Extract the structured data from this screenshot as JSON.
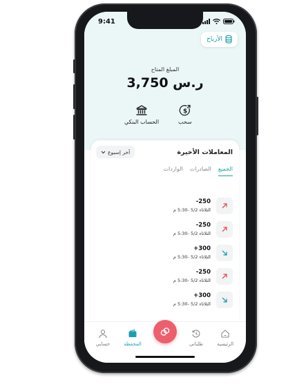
{
  "status": {
    "time": "9:41"
  },
  "header": {
    "profits_label": "الأرباح"
  },
  "balance": {
    "label": "المبلغ المتاح",
    "value": "3,750 ر.س"
  },
  "actions": {
    "withdraw": "سحب",
    "bank": "الحساب البنكي"
  },
  "transactions": {
    "title": "المعاملات الأخيرة",
    "period": "آخر إسبوع",
    "tabs": [
      "الجميع",
      "الصادرات",
      "الواردات"
    ],
    "items": [
      {
        "amount": "-250",
        "date": "الثلاثاء 5/2 -5:30 م",
        "direction": "out"
      },
      {
        "amount": "-250",
        "date": "الثلاثاء 5/2 -5:30 م",
        "direction": "out"
      },
      {
        "amount": "+300",
        "date": "الثلاثاء 5/2 -5:30 م",
        "direction": "in"
      },
      {
        "amount": "-250",
        "date": "الثلاثاء 5/2 -5:30 م",
        "direction": "out"
      },
      {
        "amount": "+300",
        "date": "الثلاثاء 5/2 -5:30 م",
        "direction": "in"
      }
    ]
  },
  "nav": {
    "home": "الرئيسية",
    "orders": "طلباتي",
    "wallet": "المحفظة",
    "account": "حسابي"
  },
  "colors": {
    "accent": "#1ba0b0",
    "fab": "#ee5f6e",
    "out_arrow": "#e5504f",
    "in_arrow": "#1ba0b0"
  }
}
